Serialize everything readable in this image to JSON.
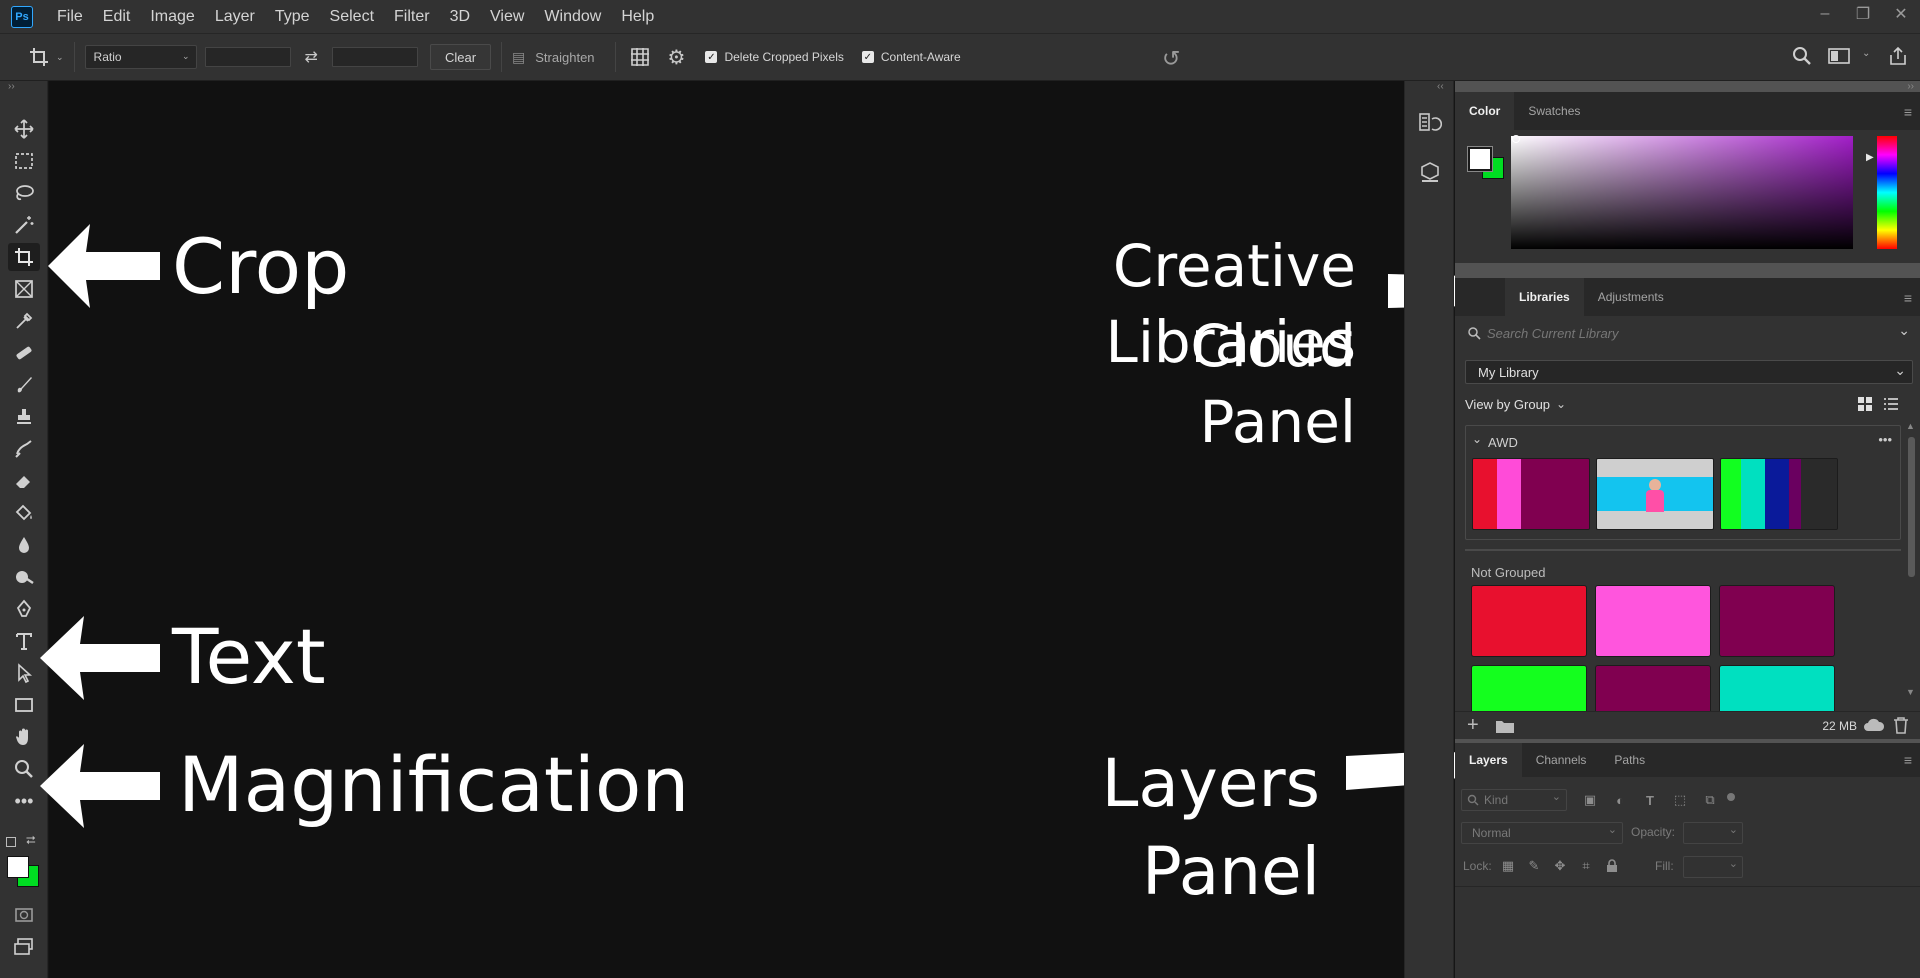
{
  "app": {
    "logo": "Ps"
  },
  "menu": [
    "File",
    "Edit",
    "Image",
    "Layer",
    "Type",
    "Select",
    "Filter",
    "3D",
    "View",
    "Window",
    "Help"
  ],
  "window_controls": {
    "minimize": "–",
    "restore": "❐",
    "close": "✕"
  },
  "options": {
    "ratio_select": "Ratio",
    "clear_label": "Clear",
    "straighten_label": "Straighten",
    "delete_cropped_label": "Delete Cropped Pixels",
    "delete_cropped_checked": true,
    "content_aware_label": "Content-Aware",
    "content_aware_checked": true
  },
  "annotations": {
    "crop": "Crop",
    "text": "Text",
    "magnification": "Magnification",
    "cc_line1": "Creative Cloud",
    "cc_line2": "Libraries Panel",
    "layers": "Layers Panel"
  },
  "color_panel": {
    "tabs": [
      "Color",
      "Swatches"
    ],
    "foreground": "#ffffff",
    "background": "#00dd22",
    "hue_color": "#a21ec8"
  },
  "libraries_panel": {
    "tabs": [
      "Libraries",
      "Adjustments"
    ],
    "search_placeholder": "Search Current Library",
    "library": "My Library",
    "view_by": "View by Group",
    "group_name": "AWD",
    "not_grouped_label": "Not Grouped",
    "storage": "22 MB",
    "palette_1": [
      "#e8102e",
      "#ff4bd8",
      "#800050"
    ],
    "palette_2": [
      "#12ff20",
      "#00e0c0",
      "#0a1a9a",
      "#6a0060"
    ],
    "not_grouped_colors": [
      "#e8102e",
      "#ff55dd",
      "#800050",
      "#14ff1e",
      "#800050",
      "#00e0c0"
    ]
  },
  "layers_panel": {
    "tabs": [
      "Layers",
      "Channels",
      "Paths"
    ],
    "kind_label": "Kind",
    "blend_mode": "Normal",
    "opacity_label": "Opacity:",
    "lock_label": "Lock:",
    "fill_label": "Fill:"
  }
}
